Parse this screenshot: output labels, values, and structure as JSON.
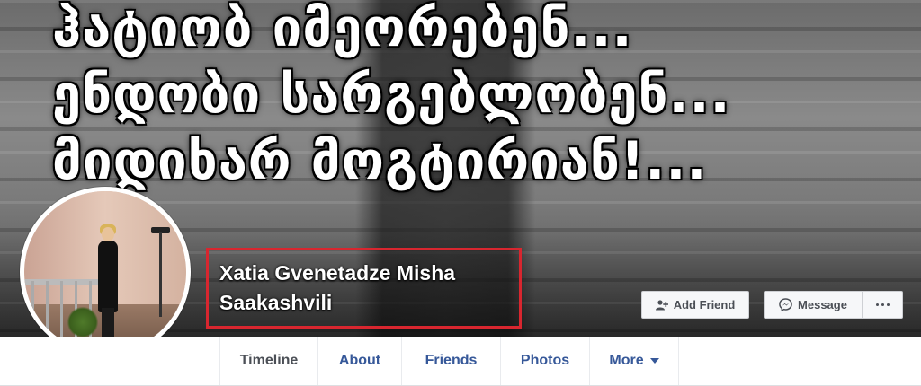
{
  "cover": {
    "lines": [
      "ჰატიობ იმეორებენ...",
      "ენდობი სარგებლობენ...",
      "მიდიხარ მოგტირიან!..."
    ]
  },
  "profile": {
    "name_line1": "Xatia Gvenetadze Misha",
    "name_line2": "Saakashvili",
    "highlight_color": "#d8262f"
  },
  "actions": {
    "add_friend": "Add Friend",
    "message": "Message"
  },
  "tabs": [
    {
      "label": "Timeline",
      "active": true
    },
    {
      "label": "About"
    },
    {
      "label": "Friends"
    },
    {
      "label": "Photos"
    },
    {
      "label": "More"
    }
  ],
  "colors": {
    "link": "#365899",
    "text": "#4b4f56",
    "button_bg": "#f6f7f9"
  },
  "icons": {
    "add_friend": "add-person-icon",
    "message": "messenger-icon",
    "more_actions": "ellipsis-icon",
    "more_tab": "caret-down-icon"
  }
}
